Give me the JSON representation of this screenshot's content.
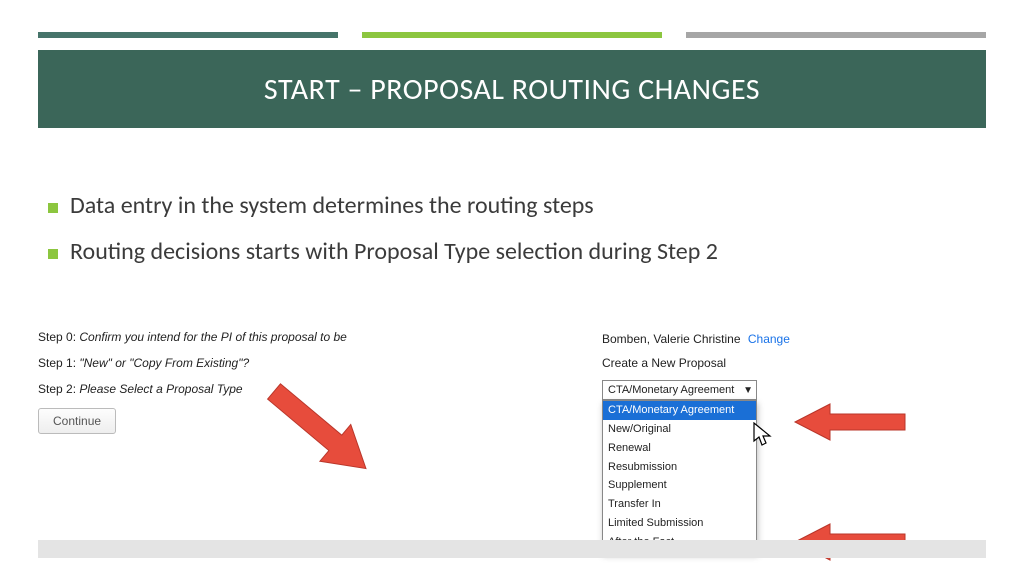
{
  "title": "START – PROPOSAL ROUTING CHANGES",
  "bullets": [
    "Data entry in the system determines the routing steps",
    "Routing decisions starts with Proposal Type selection during Step 2"
  ],
  "left": {
    "step0_label": "Step 0: ",
    "step0_text": "Confirm you intend for the PI of this proposal to be",
    "step1_label": "Step 1: ",
    "step1_text": "\"New\" or \"Copy From Existing\"?",
    "step2_label": "Step 2: ",
    "step2_text": "Please Select a Proposal Type",
    "continue": "Continue"
  },
  "right": {
    "pi_name": "Bomben, Valerie Christine",
    "change": "Change",
    "create": "Create a New Proposal",
    "selected": "CTA/Monetary Agreement",
    "options": [
      "CTA/Monetary Agreement",
      "New/Original",
      "Renewal",
      "Resubmission",
      "Supplement",
      "Transfer In",
      "Limited Submission",
      "After the Fact"
    ]
  }
}
